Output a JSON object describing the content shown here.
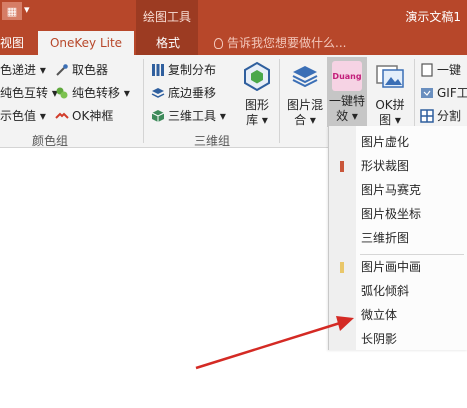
{
  "titlebar": {
    "qat_grid_icon": "▦",
    "qat_arrow": "▾",
    "tool_group_title": "绘图工具",
    "app_title": "演示文稿1"
  },
  "tabs": {
    "view": "视图",
    "onekey": "OneKey Lite",
    "format": "格式"
  },
  "tell_me": {
    "placeholder": "告诉我您想要做什么..."
  },
  "ribbon": {
    "color_group": {
      "items": [
        "色递进 ▾",
        "纯色互转 ▾",
        "示色值 ▾"
      ],
      "items_right": [
        "取色器",
        "纯色转移 ▾",
        "OK神框"
      ],
      "label": "颜色组"
    },
    "threed_group": {
      "items": [
        "复制分布",
        "底边垂移",
        "三维工具 ▾"
      ],
      "big_button": [
        "图形",
        "库 ▾"
      ],
      "label": "三维组"
    },
    "image_mix": [
      "图片混",
      "合 ▾"
    ],
    "onekey_effect": [
      "一键特",
      "效 ▾"
    ],
    "duang_badge": "Duang",
    "ok_collage": [
      "OK拼",
      "图 ▾"
    ],
    "right_items": [
      "一键",
      "GIF工",
      "分割"
    ]
  },
  "menu": {
    "items": [
      {
        "label": "图片虚化"
      },
      {
        "label": "形状裁图"
      },
      {
        "label": "图片马赛克"
      },
      {
        "label": "图片极坐标"
      },
      {
        "label": "三维折图"
      },
      {
        "label": "图片画中画"
      },
      {
        "label": "弧化倾斜"
      },
      {
        "label": "微立体"
      },
      {
        "label": "长阴影"
      }
    ]
  },
  "colors": {
    "accent": "#b7472a",
    "arrow": "#d42a24",
    "mark_red": "#c9563a",
    "mark_yellow": "#e9c76a"
  }
}
